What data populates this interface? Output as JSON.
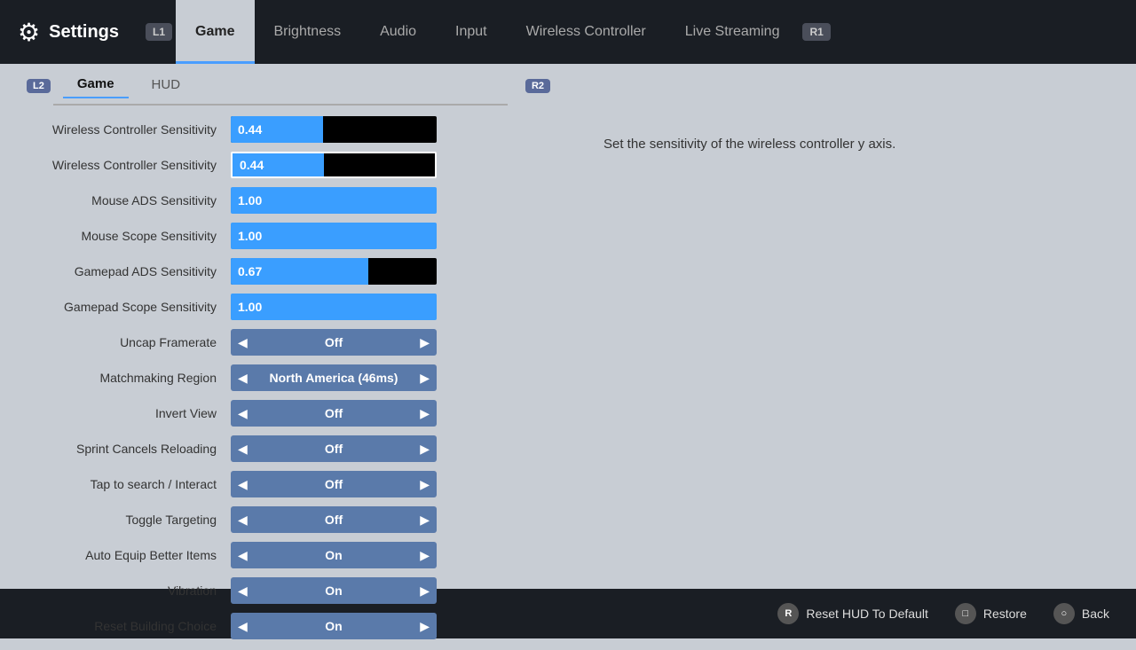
{
  "app": {
    "title": "Settings",
    "gear_icon": "⚙"
  },
  "top_nav": {
    "l1_label": "L1",
    "r1_label": "R1",
    "tabs": [
      {
        "id": "game",
        "label": "Game",
        "active": true
      },
      {
        "id": "brightness",
        "label": "Brightness",
        "active": false
      },
      {
        "id": "audio",
        "label": "Audio",
        "active": false
      },
      {
        "id": "input",
        "label": "Input",
        "active": false
      },
      {
        "id": "wireless",
        "label": "Wireless Controller",
        "active": false
      },
      {
        "id": "streaming",
        "label": "Live Streaming",
        "active": false
      }
    ]
  },
  "sub_tabs": {
    "l2_label": "L2",
    "r2_label": "R2",
    "items": [
      {
        "id": "game",
        "label": "Game",
        "active": true
      },
      {
        "id": "hud",
        "label": "HUD",
        "active": false
      }
    ]
  },
  "description": "Set the sensitivity of the wireless controller y axis.",
  "settings": [
    {
      "label": "Wireless Controller Sensitivity",
      "type": "slider",
      "value": "0.44",
      "fill_pct": 45,
      "selected": false
    },
    {
      "label": "Wireless Controller Sensitivity",
      "type": "slider",
      "value": "0.44",
      "fill_pct": 45,
      "selected": true
    },
    {
      "label": "Mouse ADS Sensitivity",
      "type": "slider",
      "value": "1.00",
      "fill_pct": 100,
      "selected": false
    },
    {
      "label": "Mouse Scope Sensitivity",
      "type": "slider",
      "value": "1.00",
      "fill_pct": 100,
      "selected": false
    },
    {
      "label": "Gamepad ADS Sensitivity",
      "type": "slider",
      "value": "0.67",
      "fill_pct": 67,
      "selected": false
    },
    {
      "label": "Gamepad Scope Sensitivity",
      "type": "slider",
      "value": "1.00",
      "fill_pct": 100,
      "selected": false
    },
    {
      "label": "Uncap Framerate",
      "type": "toggle",
      "value": "Off"
    },
    {
      "label": "Matchmaking Region",
      "type": "toggle",
      "value": "North America (46ms)"
    },
    {
      "label": "Invert View",
      "type": "toggle",
      "value": "Off"
    },
    {
      "label": "Sprint Cancels Reloading",
      "type": "toggle",
      "value": "Off"
    },
    {
      "label": "Tap to search / Interact",
      "type": "toggle",
      "value": "Off"
    },
    {
      "label": "Toggle Targeting",
      "type": "toggle",
      "value": "Off"
    },
    {
      "label": "Auto Equip Better Items",
      "type": "toggle",
      "value": "On"
    },
    {
      "label": "Vibration",
      "type": "toggle",
      "value": "On"
    },
    {
      "label": "Reset Building Choice",
      "type": "toggle",
      "value": "On"
    }
  ],
  "bottom_bar": {
    "reset_label": "Reset HUD To Default",
    "restore_label": "Restore",
    "back_label": "Back",
    "reset_icon": "R",
    "restore_icon": "□",
    "back_icon": "○"
  }
}
